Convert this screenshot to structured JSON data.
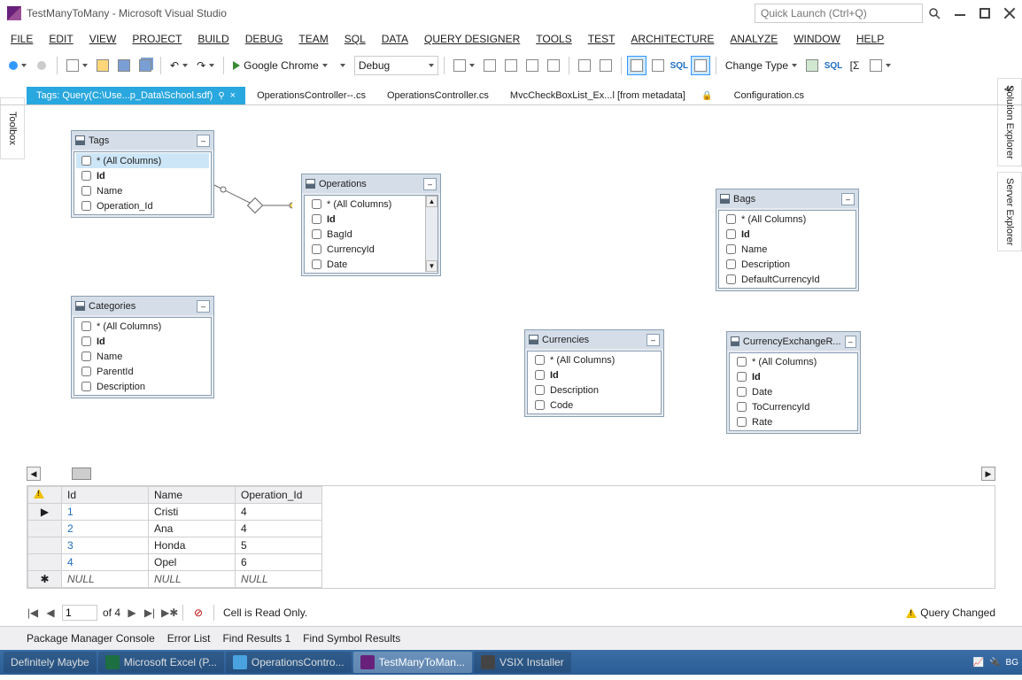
{
  "app": {
    "title": "TestManyToMany - Microsoft Visual Studio",
    "quick_launch_placeholder": "Quick Launch (Ctrl+Q)"
  },
  "menus": {
    "file": "FILE",
    "edit": "EDIT",
    "view": "VIEW",
    "project": "PROJECT",
    "build": "BUILD",
    "debug": "DEBUG",
    "team": "TEAM",
    "sql": "SQL",
    "data": "DATA",
    "query_designer": "QUERY DESIGNER",
    "tools": "TOOLS",
    "test": "TEST",
    "architecture": "ARCHITECTURE",
    "analyze": "ANALYZE",
    "window": "WINDOW",
    "help": "HELP"
  },
  "toolbar": {
    "browser": "Google Chrome",
    "config": "Debug",
    "change_type": "Change Type",
    "sql_label": "SQL"
  },
  "side": {
    "toolbox": "Toolbox",
    "solution_explorer": "Solution Explorer",
    "server_explorer": "Server Explorer"
  },
  "tabs": {
    "active": "Tags: Query(C:\\Use...p_Data\\School.sdf)",
    "t1": "OperationsController--.cs",
    "t2": "OperationsController.cs",
    "t3": "MvcCheckBoxList_Ex...l [from metadata]",
    "t4": "Configuration.cs"
  },
  "tables": {
    "tags": {
      "title": "Tags",
      "cols": [
        "* (All Columns)",
        "Id",
        "Name",
        "Operation_Id"
      ]
    },
    "operations": {
      "title": "Operations",
      "cols": [
        "* (All Columns)",
        "Id",
        "BagId",
        "CurrencyId",
        "Date"
      ]
    },
    "categories": {
      "title": "Categories",
      "cols": [
        "* (All Columns)",
        "Id",
        "Name",
        "ParentId",
        "Description"
      ]
    },
    "bags": {
      "title": "Bags",
      "cols": [
        "* (All Columns)",
        "Id",
        "Name",
        "Description",
        "DefaultCurrencyId"
      ]
    },
    "currencies": {
      "title": "Currencies",
      "cols": [
        "* (All Columns)",
        "Id",
        "Description",
        "Code"
      ]
    },
    "cer": {
      "title": "CurrencyExchangeR...",
      "cols": [
        "* (All Columns)",
        "Id",
        "Date",
        "ToCurrencyId",
        "Rate"
      ]
    }
  },
  "grid": {
    "headers": [
      "Id",
      "Name",
      "Operation_Id"
    ],
    "rows": [
      {
        "id": "1",
        "name": "Cristi",
        "op": "4"
      },
      {
        "id": "2",
        "name": "Ana",
        "op": "4"
      },
      {
        "id": "3",
        "name": "Honda",
        "op": "5"
      },
      {
        "id": "4",
        "name": "Opel",
        "op": "6"
      }
    ],
    "null": "NULL"
  },
  "nav": {
    "current": "1",
    "total": "of 4",
    "readonly": "Cell is Read Only.",
    "query_changed": "Query Changed"
  },
  "bottom": {
    "pmc": "Package Manager Console",
    "el": "Error List",
    "fr": "Find Results 1",
    "fsr": "Find Symbol Results"
  },
  "taskbar": {
    "i0": "Definitely Maybe",
    "i1": "Microsoft Excel (P...",
    "i2": "OperationsContro...",
    "i3": "TestManyToMan...",
    "i4": "VSIX Installer",
    "lang": "BG"
  }
}
